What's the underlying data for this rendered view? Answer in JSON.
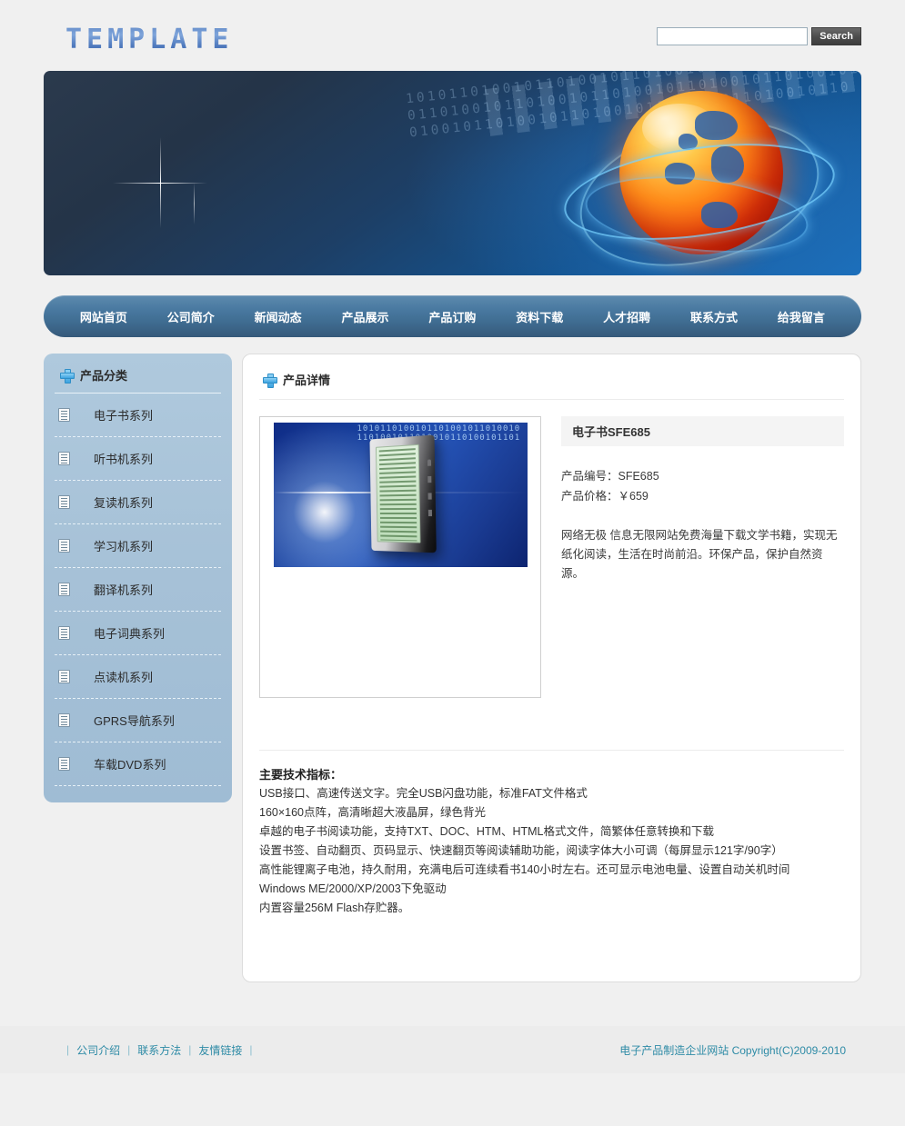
{
  "header": {
    "logo_text": "TEMPLATE",
    "search": {
      "value": "",
      "placeholder": "",
      "button_label": "Search",
      "icon": "search-icon"
    }
  },
  "banner": {
    "alt": "globe-network-banner",
    "binary_text": "1010110100101101001011010010110100101101001011010010110100101101001011010010110100101101001011010010110100101101001011010010110"
  },
  "nav": {
    "items": [
      {
        "label": "网站首页"
      },
      {
        "label": "公司简介"
      },
      {
        "label": "新闻动态"
      },
      {
        "label": "产品展示"
      },
      {
        "label": "产品订购"
      },
      {
        "label": "资料下载"
      },
      {
        "label": "人才招聘"
      },
      {
        "label": "联系方式"
      },
      {
        "label": "给我留言"
      }
    ]
  },
  "sidebar": {
    "title": "产品分类",
    "title_icon": "plus-icon",
    "items": [
      {
        "label": "电子书系列",
        "icon": "document-icon"
      },
      {
        "label": "听书机系列",
        "icon": "document-icon"
      },
      {
        "label": "复读机系列",
        "icon": "document-icon"
      },
      {
        "label": "学习机系列",
        "icon": "document-icon"
      },
      {
        "label": "翻译机系列",
        "icon": "document-icon"
      },
      {
        "label": "电子词典系列",
        "icon": "document-icon"
      },
      {
        "label": "点读机系列",
        "icon": "document-icon"
      },
      {
        "label": "GPRS导航系列",
        "icon": "document-icon"
      },
      {
        "label": "车载DVD系列",
        "icon": "document-icon"
      }
    ]
  },
  "main": {
    "title": "产品详情",
    "title_icon": "plus-icon",
    "product": {
      "image_alt": "ebook-reader-product-photo",
      "name": "电子书SFE685",
      "code_label": "产品编号：SFE685",
      "price_label": "产品价格：￥659",
      "description": "网络无极 信息无限网站免费海量下载文学书籍，实现无纸化阅读，生活在时尚前沿。环保产品，保护自然资源。"
    },
    "specs": {
      "title": "主要技术指标：",
      "lines": [
        "USB接口、高速传送文字。完全USB闪盘功能，标准FAT文件格式",
        "160×160点阵，高清晰超大液晶屏，绿色背光",
        "卓越的电子书阅读功能，支持TXT、DOC、HTM、HTML格式文件，简繁体任意转换和下载",
        "设置书签、自动翻页、页码显示、快速翻页等阅读辅助功能，阅读字体大小可调（每屏显示121字/90字）",
        "高性能锂离子电池，持久耐用，充满电后可连续看书140小时左右。还可显示电池电量、设置自动关机时间",
        "Windows ME/2000/XP/2003下免驱动",
        "内置容量256M Flash存贮器。"
      ]
    }
  },
  "footer": {
    "links": [
      {
        "label": "公司介绍"
      },
      {
        "label": "联系方法"
      },
      {
        "label": "友情链接"
      }
    ],
    "copyright": "电子产品制造企业网站  Copyright(C)2009-2010"
  },
  "colors": {
    "nav_blue": "#4a7aa1",
    "sidebar_blue": "#a6c1d7",
    "accent_cyan": "#2e8ba6",
    "logo_blue": "#5f87c4",
    "page_bg": "#f0f0f0"
  }
}
